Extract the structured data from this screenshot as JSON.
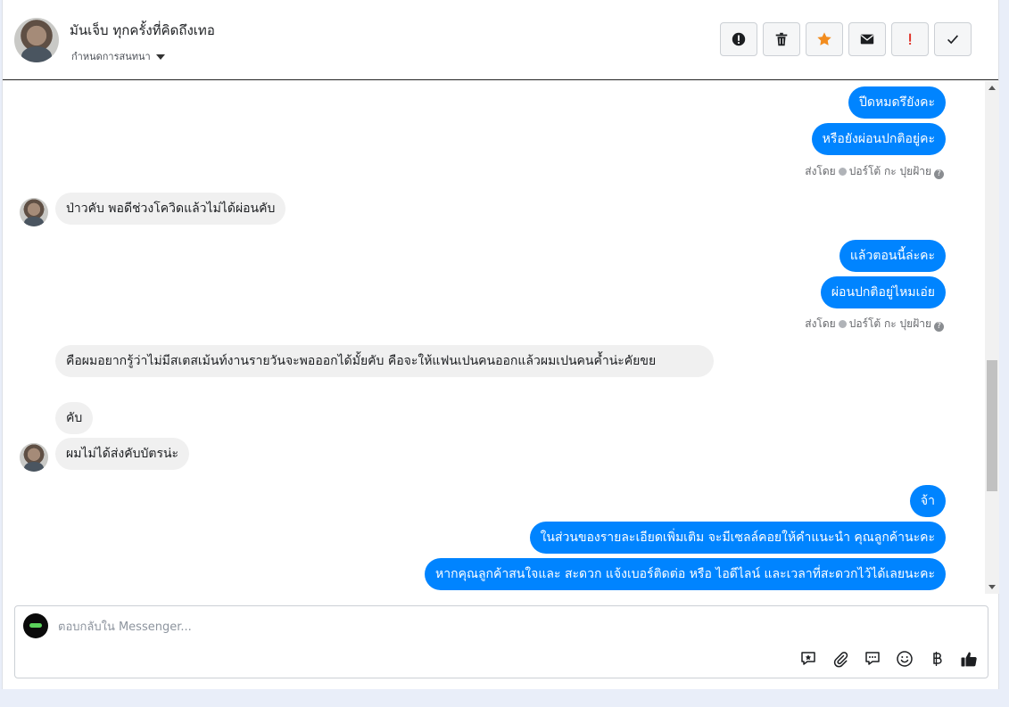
{
  "header": {
    "contact_name": "มันเจ็บ ทุกครั้งที่คิดถึงเทอ",
    "assign_label": "กำหนดการสนทนา"
  },
  "actions": [
    {
      "name": "spam-alert",
      "icon": "exclamation-circle-icon"
    },
    {
      "name": "delete",
      "icon": "trash-icon"
    },
    {
      "name": "star",
      "icon": "star-icon",
      "color": "#f28c1e"
    },
    {
      "name": "mark-unread",
      "icon": "envelope-icon"
    },
    {
      "name": "follow-up",
      "icon": "exclamation-icon",
      "color": "#e0332a"
    },
    {
      "name": "mark-done",
      "icon": "check-icon"
    }
  ],
  "messages": {
    "m1": "ปีดหมดรึยังคะ",
    "m2": "หรือยังผ่อนปกติอยู่คะ",
    "sent1": {
      "prefix": "ส่งโดย",
      "sender": "ปอร์โต้ กะ ปุยฝ้าย"
    },
    "m3": "ป่าวคับ พอดีช่วงโควิดแล้วไม่ได้ผ่อนคับ",
    "m4": "แล้วตอนนี้ล่ะคะ",
    "m5": "ผ่อนปกติอยู่ไหมเอ่ย",
    "sent2": {
      "prefix": "ส่งโดย",
      "sender": "ปอร์โต้ กะ ปุยฝ้าย"
    },
    "m6": "คือผมอยากรู้ว่าไม่มีสเตสเม้นท์งานรายวันจะพอออกได้มั้ยคับ คือจะให้แฟนเปนคนออกแล้วผมเปนคนค้ำน่ะคัยขย",
    "m7": "คับ",
    "m8": "ผมไม่ได้ส่งคับบัตรน่ะ",
    "m9": "จ้า",
    "m10": "ในส่วนของรายละเอียดเพิ่มเติม จะมีเซลล์คอยให้คำแนะนำ คุณลูกค้านะคะ",
    "m11": "หากคุณลูกค้าสนใจและ สะดวก แจ้งเบอร์ติดต่อ หรือ ไอดีไลน์ และเวลาที่สะดวกไว้ได้เลยนะคะ"
  },
  "composer": {
    "placeholder": "ตอบกลับใน Messenger...",
    "tools": [
      "saved-reply-icon",
      "paperclip-icon",
      "comment-icon",
      "emoji-icon",
      "baht-icon",
      "thumbs-up-icon"
    ]
  },
  "colors": {
    "outgoing": "#0084ff",
    "incoming": "#f0f0f0"
  }
}
